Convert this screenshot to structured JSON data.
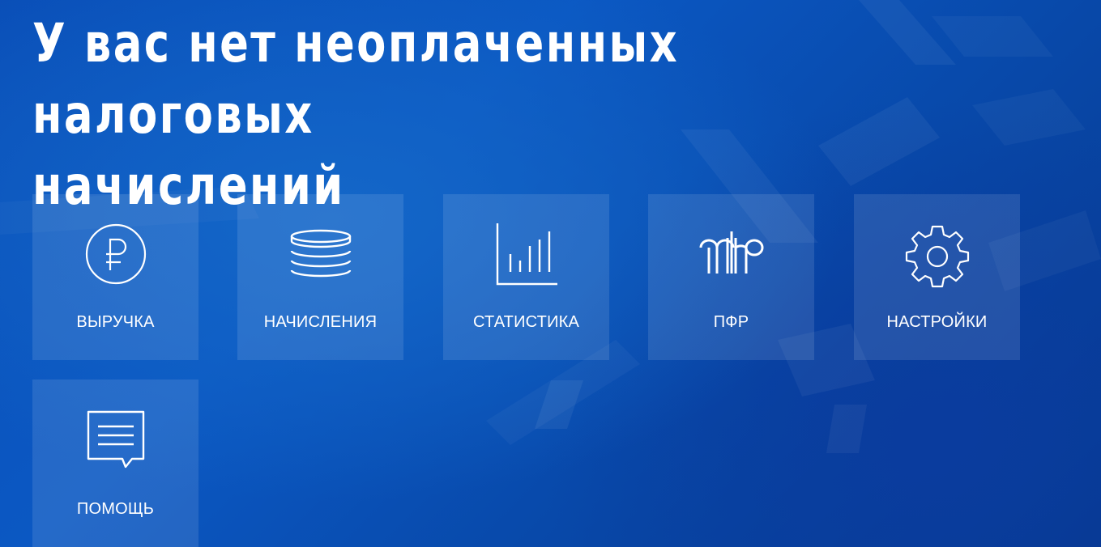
{
  "header": {
    "title_line1": "У вас нет неоплаченных налоговых",
    "title_line2": "начислений"
  },
  "tiles": [
    {
      "id": "revenue",
      "label": "ВЫРУЧКА",
      "icon": "ruble-icon"
    },
    {
      "id": "accruals",
      "label": "НАЧИСЛЕНИЯ",
      "icon": "coins-stack-icon"
    },
    {
      "id": "statistics",
      "label": "СТАТИСТИКА",
      "icon": "bar-chart-icon"
    },
    {
      "id": "pfr",
      "label": "ПФР",
      "icon": "pfr-logo-icon"
    },
    {
      "id": "settings",
      "label": "НАСТРОЙКИ",
      "icon": "gear-icon"
    },
    {
      "id": "help",
      "label": "ПОМОЩЬ",
      "icon": "chat-message-icon"
    }
  ],
  "colors": {
    "background": "#0a4fb8",
    "tile": "#ffffff1c",
    "text": "#ffffff"
  }
}
